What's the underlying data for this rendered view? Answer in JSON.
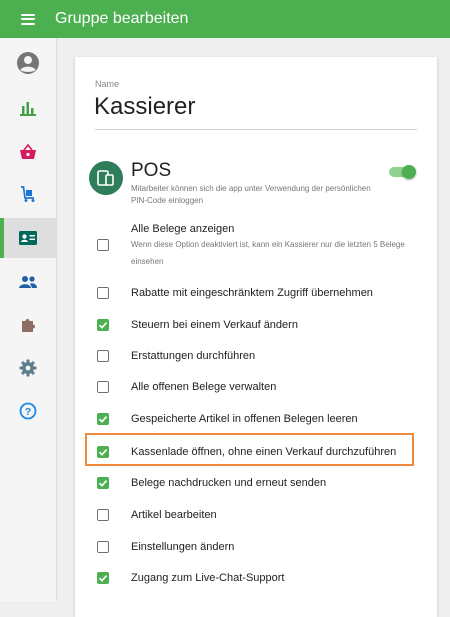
{
  "header": {
    "title": "Gruppe bearbeiten"
  },
  "sidebar": {
    "items": [
      {
        "icon": "account-icon"
      },
      {
        "icon": "bar-chart-icon"
      },
      {
        "icon": "basket-icon"
      },
      {
        "icon": "cart-icon"
      },
      {
        "icon": "employee-card-icon",
        "active": true
      },
      {
        "icon": "people-icon"
      },
      {
        "icon": "puzzle-icon"
      },
      {
        "icon": "gear-icon"
      },
      {
        "icon": "help-icon"
      }
    ]
  },
  "form": {
    "name_label": "Name",
    "name_value": "Kassierer",
    "section_title": "POS",
    "section_desc": "Mitarbeiter können sich die app unter Verwendung der persönlichen PIN-Code einloggen",
    "section_enabled": true
  },
  "permissions": [
    {
      "label": "Alle Belege anzeigen",
      "desc": "Wenn diese Option deaktiviert ist, kann ein Kassierer nur die letzten 5 Belege einsehen",
      "checked": false
    },
    {
      "label": "Rabatte mit eingeschränktem Zugriff übernehmen",
      "checked": false
    },
    {
      "label": "Steuern bei einem Verkauf ändern",
      "checked": true
    },
    {
      "label": "Erstattungen durchführen",
      "checked": false
    },
    {
      "label": "Alle offenen Belege verwalten",
      "checked": false
    },
    {
      "label": "Gespeicherte Artikel in offenen Belegen leeren",
      "checked": true
    },
    {
      "label": "Kassenlade öffnen, ohne einen Verkauf durchzuführen",
      "checked": true,
      "highlighted": true
    },
    {
      "label": "Belege nachdrucken und erneut senden",
      "checked": true
    },
    {
      "label": "Artikel bearbeiten",
      "checked": false
    },
    {
      "label": "Einstellungen ändern",
      "checked": false
    },
    {
      "label": "Zugang zum Live-Chat-Support",
      "checked": true
    }
  ],
  "colors": {
    "primary": "#4caf50",
    "highlight": "#f08a3c",
    "pos_icon": "#2e7d5b"
  }
}
